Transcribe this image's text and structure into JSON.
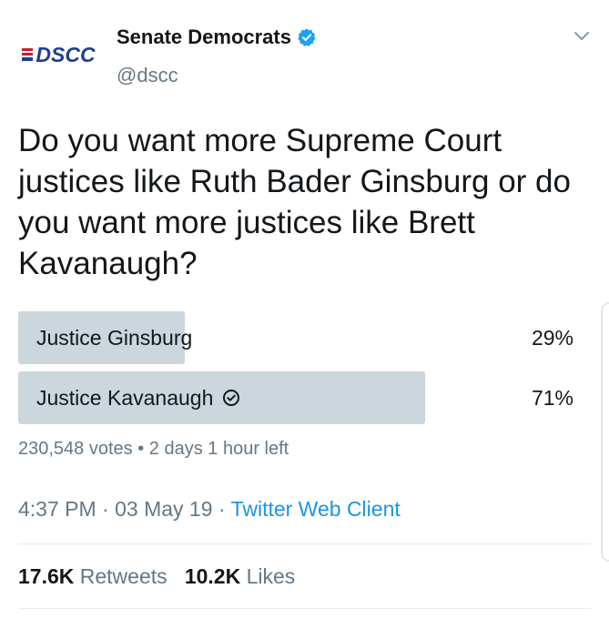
{
  "account": {
    "logo_text": "DSCC",
    "display_name": "Senate Democrats",
    "handle": "@dscc"
  },
  "tweet": {
    "text": "Do you want more Supreme Court justices like Ruth Bader Ginsburg or do you want more justices like Brett Kavanaugh?"
  },
  "poll": {
    "options": [
      {
        "label": "Justice Ginsburg",
        "percent_text": "29%",
        "percent": 29,
        "winner": false
      },
      {
        "label": "Justice Kavanaugh",
        "percent_text": "71%",
        "percent": 71,
        "winner": true
      }
    ],
    "votes": "230,548 votes",
    "separator": "•",
    "time_left": "2 days 1 hour left"
  },
  "meta": {
    "time": "4:37 PM",
    "dot": "·",
    "date": "03 May 19",
    "source": "Twitter Web Client"
  },
  "stats": {
    "retweets_count": "17.6K",
    "retweets_label": "Retweets",
    "likes_count": "10.2K",
    "likes_label": "Likes"
  },
  "colors": {
    "poll_bar": "#ccd6dd",
    "link": "#1b95e0",
    "secondary_text": "#657786",
    "verified": "#1da1f2",
    "logo": "#1f3f8f"
  },
  "icons": {
    "verified": "verified-badge-icon",
    "chevron": "chevron-down-icon",
    "check": "check-circle-icon"
  }
}
